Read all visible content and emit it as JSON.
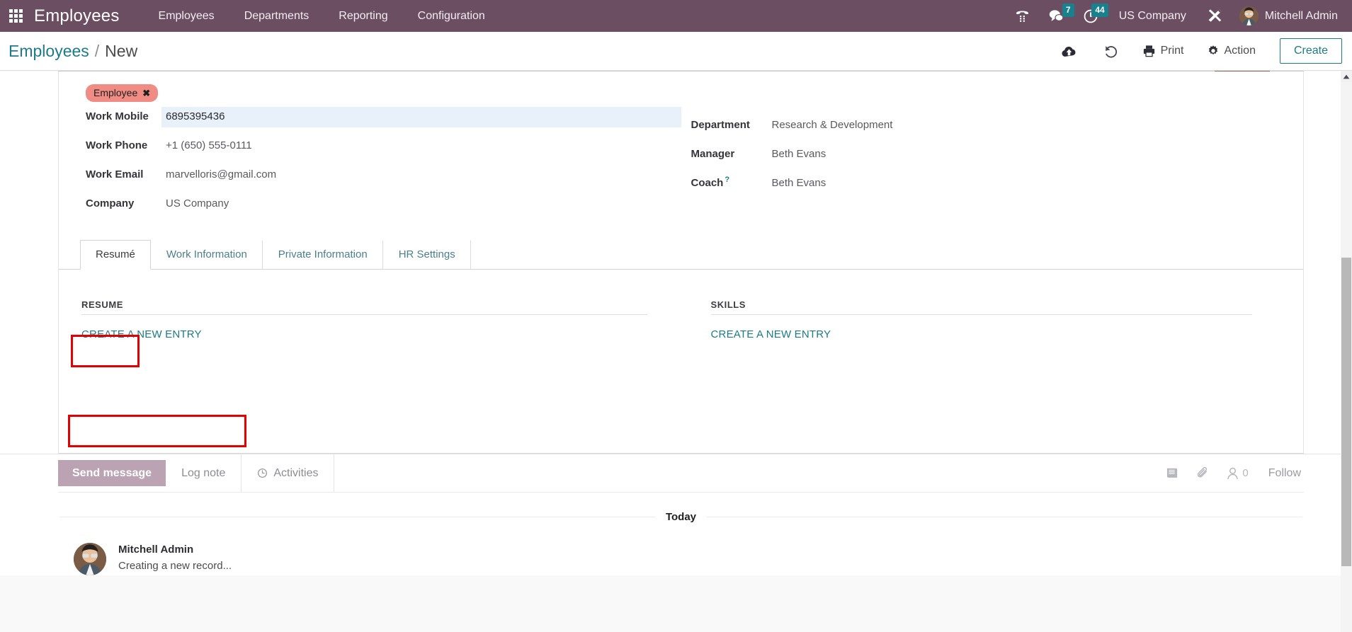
{
  "navbar": {
    "apps_icon": "apps-grid-icon",
    "brand": "Employees",
    "menu": [
      {
        "label": "Employees"
      },
      {
        "label": "Departments"
      },
      {
        "label": "Reporting"
      },
      {
        "label": "Configuration"
      }
    ],
    "systray": {
      "voip_icon": "phone-dialpad-icon",
      "messages_icon": "chat-bubble-icon",
      "messages_count": "7",
      "activities_icon": "clock-icon",
      "activities_count": "44",
      "company": "US Company",
      "debug_icon": "wrench-tools-icon",
      "user_name": "Mitchell Admin",
      "user_avatar": "user-avatar"
    }
  },
  "control_panel": {
    "breadcrumb_root": "Employees",
    "breadcrumb_sep": "/",
    "breadcrumb_current": "New",
    "save_icon": "cloud-upload-icon",
    "discard_icon": "undo-icon",
    "print_label": "Print",
    "print_icon": "printer-icon",
    "action_label": "Action",
    "action_icon": "gear-icon",
    "create_label": "Create"
  },
  "form": {
    "tag": {
      "label": "Employee",
      "remove_icon": "remove-tag-x-icon"
    },
    "left_fields": [
      {
        "label": "Work Mobile",
        "value": "6895395436",
        "highlight": true
      },
      {
        "label": "Work Phone",
        "value": "+1 (650) 555-0111",
        "highlight": false
      },
      {
        "label": "Work Email",
        "value": "marvelloris@gmail.com",
        "highlight": false
      },
      {
        "label": "Company",
        "value": "US Company",
        "highlight": false
      }
    ],
    "right_fields": [
      {
        "label": "Department",
        "value": "Research & Development",
        "help": ""
      },
      {
        "label": "Manager",
        "value": "Beth Evans",
        "help": ""
      },
      {
        "label": "Coach",
        "value": "Beth Evans",
        "help": "?"
      }
    ]
  },
  "notebook": {
    "tabs": [
      {
        "label": "Resumé",
        "active": true
      },
      {
        "label": "Work Information",
        "active": false
      },
      {
        "label": "Private Information",
        "active": false
      },
      {
        "label": "HR Settings",
        "active": false
      }
    ],
    "resume_section": {
      "title": "RESUME",
      "add_label": "CREATE A NEW ENTRY"
    },
    "skills_section": {
      "title": "SKILLS",
      "add_label": "CREATE A NEW ENTRY"
    }
  },
  "chatter": {
    "send_message": "Send message",
    "log_note": "Log note",
    "activities": "Activities",
    "activities_icon": "clock-icon",
    "log_icon": "book-icon",
    "attachment_icon": "paperclip-icon",
    "followers_icon": "person-icon",
    "followers_count": "0",
    "follow_label": "Follow",
    "day_label": "Today",
    "messages": [
      {
        "author": "Mitchell Admin",
        "text": "Creating a new record...",
        "avatar": "author-avatar"
      }
    ]
  },
  "colors": {
    "navbar_bg": "#6b4e62",
    "accent_teal": "#1f7b87",
    "badge_teal": "#17818e",
    "tag_red": "#f08c84",
    "annotation_red": "#e20000",
    "field_highlight": "#e8f0fa",
    "composer_active": "#bba3b4"
  },
  "scrollbar": {
    "up_arrow_icon": "chevron-up-icon"
  }
}
